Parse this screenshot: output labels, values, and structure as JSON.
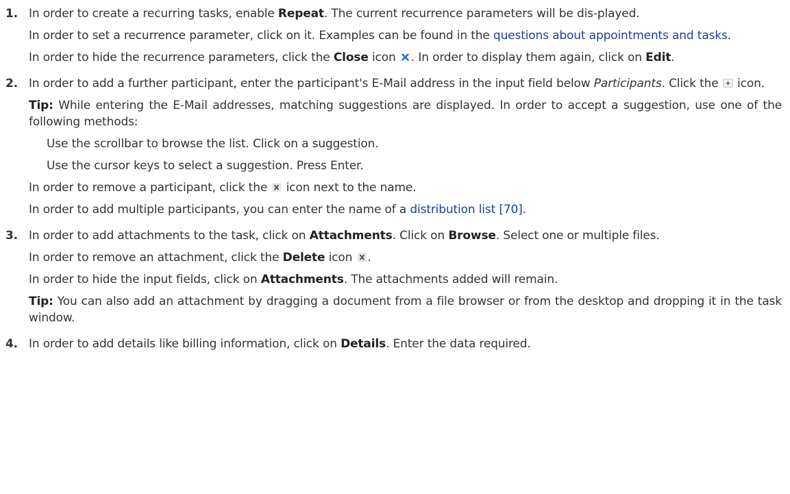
{
  "steps": [
    {
      "number": "1.",
      "p1": {
        "a": "In order to create a recurring tasks, enable ",
        "b": "Repeat",
        "c": ". The current recurrence parameters will be dis-played."
      },
      "p2": {
        "a": "In order to set a recurrence parameter, click on it. Examples can be found in the ",
        "link": "questions about appointments and tasks",
        "c": "."
      },
      "p3": {
        "a": "In order to hide the recurrence parameters, click the ",
        "b": "Close",
        "c": " icon ",
        "d": ". In order to display them again, click on ",
        "e": "Edit",
        "f": "."
      }
    },
    {
      "number": "2.",
      "p1": {
        "a": "In order to add a further participant, enter the participant's E-Mail address in the input field below ",
        "i": "Participants",
        "c": ". Click the ",
        "d": " icon."
      },
      "tip": {
        "label": "Tip:",
        "text": " While entering the E-Mail addresses, matching suggestions are displayed. In order to accept a suggestion, use one of the following methods:"
      },
      "bullets": [
        "Use the scrollbar to browse the list. Click on a suggestion.",
        "Use the cursor keys to select a suggestion. Press Enter."
      ],
      "p3": {
        "a": "In order to remove a participant, click the ",
        "c": " icon next to the name."
      },
      "p4": {
        "a": "In order to add multiple participants, you can enter the name of a ",
        "link": "distribution list [70]",
        "c": "."
      }
    },
    {
      "number": "3.",
      "p1": {
        "a": "In order to add attachments to the task, click on ",
        "b": "Attachments",
        "c": ". Click on ",
        "d": "Browse",
        "e": ". Select one or multiple files."
      },
      "p2": {
        "a": "In order to remove an attachment, click the ",
        "b": "Delete",
        "c": " icon ",
        "d": "."
      },
      "p3": {
        "a": "In order to hide the input fields, click on ",
        "b": "Attachments",
        "c": ". The attachments added will remain."
      },
      "tip": {
        "label": "Tip:",
        "text": " You can also add an attachment by dragging a document from a file browser or from the desktop and dropping it in the task window."
      }
    },
    {
      "number": "4.",
      "p1": {
        "a": "In order to add details like billing information, click on ",
        "b": "Details",
        "c": ". Enter the data required."
      }
    }
  ],
  "icons": {
    "close": "close-x-icon",
    "add": "plus-icon",
    "remove": "remove-x-icon",
    "delete": "delete-x-icon"
  },
  "colors": {
    "link": "#1a3f9a",
    "close_icon": "#2a6fd6"
  }
}
